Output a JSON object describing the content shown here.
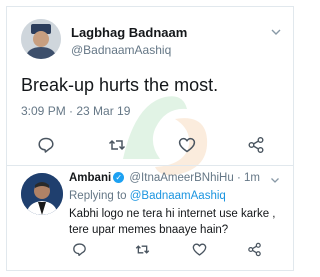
{
  "tweet": {
    "name": "Lagbhag Badnaam",
    "handle": "@BadnaamAashiq",
    "text": "Break-up hurts the most.",
    "meta": "3:09 PM · 23 Mar 19"
  },
  "reply": {
    "name": "Ambani",
    "handle": "@ItnaAmeerBNhiHu",
    "separator": "·",
    "time": "1m",
    "replying_to_prefix": "Replying to ",
    "replying_to_handle": "@BadnaamAashiq",
    "text": "Kabhi logo ne  tera hi internet use karke , tere upar memes bnaaye hain?"
  },
  "icons": [
    "reply-icon",
    "retweet-icon",
    "like-icon",
    "share-icon",
    "chevron-down-icon",
    "verified-icon"
  ],
  "colors": {
    "text": "#14171a",
    "secondary": "#657786",
    "link": "#1b95e0",
    "verified": "#1da1f2",
    "border": "#e1e8ed"
  }
}
